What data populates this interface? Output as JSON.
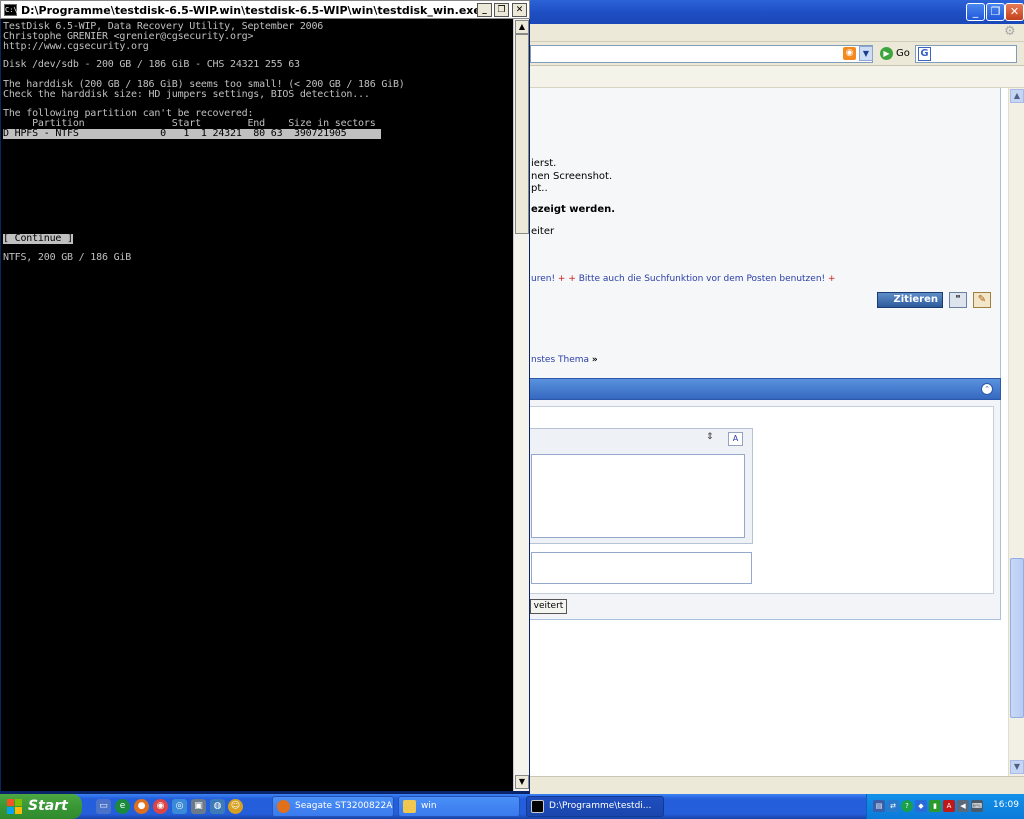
{
  "console": {
    "title": "D:\\Programme\\testdisk-6.5-WIP.win\\testdisk-6.5-WIP\\win\\testdisk_win.exe",
    "lines": [
      "TestDisk 6.5-WIP, Data Recovery Utility, September 2006",
      "Christophe GRENIER <grenier@cgsecurity.org>",
      "http://www.cgsecurity.org",
      "",
      "Disk /dev/sdb - 200 GB / 186 GiB - CHS 24321 255 63",
      "",
      "The harddisk (200 GB / 186 GiB) seems too small! (< 200 GB / 186 GiB)",
      "Check the harddisk size: HD jumpers settings, BIOS detection...",
      "",
      "The following partition can't be recovered:",
      "     Partition               Start        End    Size in sectors"
    ],
    "selected_row": "D HPFS - NTFS              0   1  1 24321  80 63  390721905",
    "continue_label": "[ Continue ]",
    "status_line": "NTFS, 200 GB / 186 GiB"
  },
  "browser": {
    "go_label": "Go",
    "post_lines": [
      "ierst.",
      "nen Screenshot.",
      "pt..",
      "ezeigt werden.",
      "eiter"
    ],
    "notice_prefix": "uren! ",
    "notice_plus": "+ +",
    "notice_text": " Bitte auch die Suchfunktion vor dem Posten benutzen! ",
    "notice_suffix": "+",
    "quote_button": "Zitieren",
    "next_thread": "nstes Thema",
    "next_thread_arrow": "»",
    "advanced_button": "veitert"
  },
  "taskbar": {
    "start_label": "Start",
    "tasks": [
      {
        "label": "Seagate ST3200822A...",
        "icon": "firefox-icon"
      },
      {
        "label": "win",
        "icon": "folder-icon"
      },
      {
        "label": "D:\\Programme\\testdi...",
        "icon": "console-icon"
      }
    ],
    "clock": "16:09"
  },
  "colors": {
    "console_bg": "#000000",
    "console_fg": "#c0c0c0",
    "xp_blue": "#245edb",
    "start_green": "#3c9a38",
    "link_blue": "#2a3ea6",
    "plus_red": "#d01818"
  }
}
